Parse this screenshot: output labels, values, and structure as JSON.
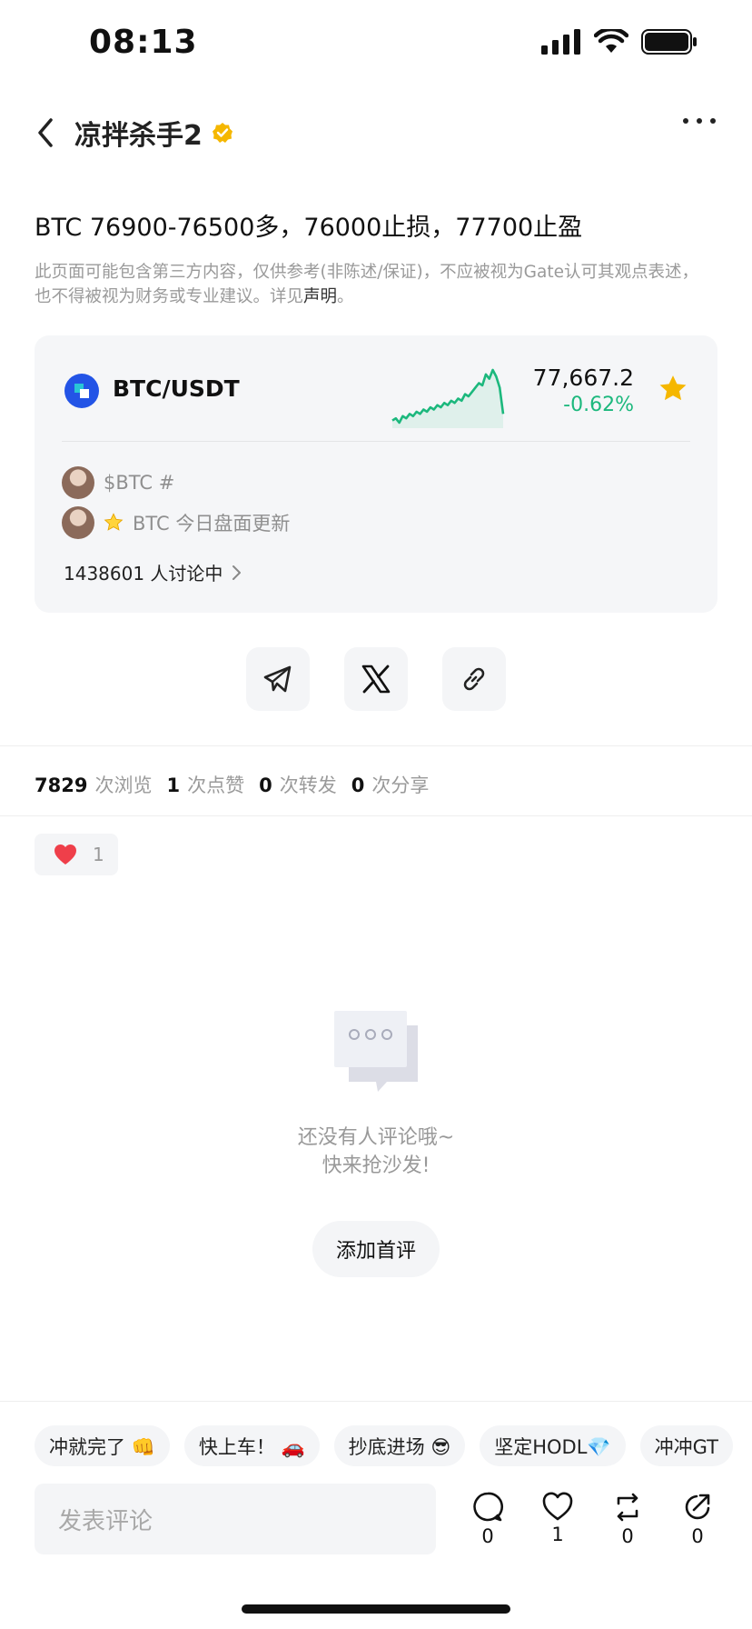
{
  "status_bar": {
    "time": "08:13"
  },
  "header": {
    "author": "凉拌杀手2"
  },
  "post": {
    "title": "BTC 76900-76500多，76000止损，77700止盈",
    "disclaimer": "此页面可能包含第三方内容，仅供参考(非陈述/保证)，不应被视为Gate认可其观点表述，也不得被视为财务或专业建议。详见",
    "disclaimer_link": "声明",
    "disclaimer_end": "。"
  },
  "market_card": {
    "pair": "BTC/USDT",
    "price": "77,667.2",
    "change": "-0.62%",
    "change_color": "#1cb87d",
    "sparkline": [
      3,
      4,
      2,
      5,
      4,
      6,
      5,
      7,
      6,
      8,
      7,
      9,
      8,
      10,
      9,
      11,
      10,
      12,
      11,
      13,
      12,
      15,
      14,
      16,
      18,
      20,
      19,
      24,
      22,
      26,
      23,
      18,
      6
    ],
    "row1": "$BTC #",
    "row2": "BTC 今日盘面更新",
    "discussion": "1438601 人讨论中"
  },
  "stats": [
    {
      "num": "7829",
      "label": "次浏览"
    },
    {
      "num": "1",
      "label": "次点赞"
    },
    {
      "num": "0",
      "label": "次转发"
    },
    {
      "num": "0",
      "label": "次分享"
    }
  ],
  "reaction": {
    "count": "1"
  },
  "empty": {
    "line1": "还没有人评论哦~",
    "line2": "快来抢沙发!",
    "button": "添加首评"
  },
  "quick_replies": [
    "冲就完了 👊",
    "快上车！ 🚗",
    "抄底进场 😎",
    "坚定HODL💎",
    "冲冲GT"
  ],
  "comment_placeholder": "发表评论",
  "actions": {
    "comment": "0",
    "like": "1",
    "repost": "0",
    "share": "0"
  }
}
